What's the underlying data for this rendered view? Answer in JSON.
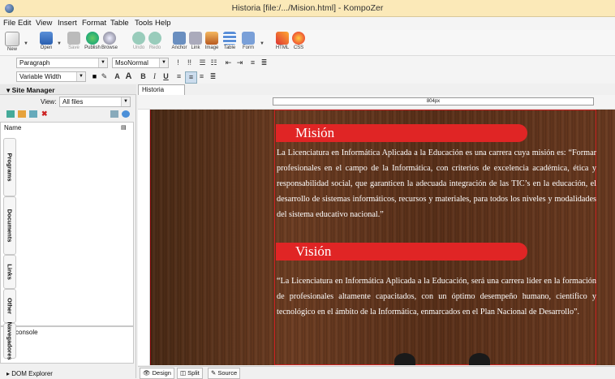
{
  "window": {
    "title": "Historia [file:/.../Mision.html] - KompoZer"
  },
  "menu": [
    "File",
    "Edit",
    "View",
    "Insert",
    "Format",
    "Table",
    "Tools",
    "Help"
  ],
  "toolbar": {
    "buttons": [
      {
        "label": "New",
        "icon": "new-icon"
      },
      {
        "label": "Open",
        "icon": "open-icon"
      },
      {
        "label": "Save",
        "icon": "save-icon"
      },
      {
        "label": "Publish",
        "icon": "publish-icon"
      },
      {
        "label": "Browse",
        "icon": "browse-icon"
      },
      {
        "label": "Undo",
        "icon": "undo-icon"
      },
      {
        "label": "Redo",
        "icon": "redo-icon"
      },
      {
        "label": "Anchor",
        "icon": "anchor-icon"
      },
      {
        "label": "Link",
        "icon": "link-icon"
      },
      {
        "label": "Image",
        "icon": "image-icon"
      },
      {
        "label": "Table",
        "icon": "table-icon"
      },
      {
        "label": "Form",
        "icon": "form-icon"
      },
      {
        "label": "HTML",
        "icon": "html-icon"
      },
      {
        "label": "CSS",
        "icon": "css-icon"
      }
    ]
  },
  "format": {
    "paragraph": "Paragraph",
    "style": "MsoNormal",
    "font": "Variable Width"
  },
  "site_manager": {
    "title": "Site Manager",
    "view_label": "View:",
    "view_value": "All files",
    "column_name": "Name",
    "vertical_tabs": [
      "Programs",
      "Documents",
      "Links",
      "Other",
      "Navegadores"
    ],
    "console_label": "console",
    "dom_explorer": "DOM Explorer"
  },
  "editor": {
    "tab": "Historia",
    "ruler": "804px",
    "mision_title": "Misión",
    "mision_text": "La Licenciatura en Informática Aplicada a la Educación es una carrera cuya misión es: “Formar profesionales en el campo de la Informática, con criterios de excelencia académica, ética y responsabilidad social, que garanticen la adecuada integración de las TIC’s en la educación, el desarrollo de sistemas informáticos, recursos y materiales, para todos los niveles y modalidades del sistema educativo nacional.”",
    "vision_title": "Visión",
    "vision_text": "“La Licenciatura en Informática Aplicada a la Educación, será una carrera líder en la formación de profesionales altamente capacitados, con un óptimo desempeño humano, científico y tecnológico en el ámbito de la Informática, enmarcados en el Plan Nacional de Desarrollo”.",
    "modes": [
      "Design",
      "Split",
      "Source"
    ]
  }
}
